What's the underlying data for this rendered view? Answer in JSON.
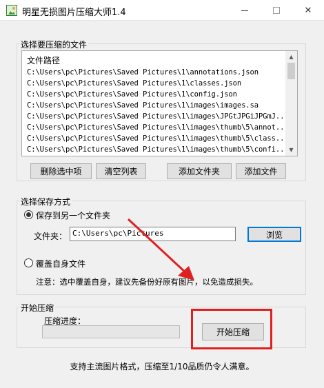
{
  "window": {
    "title": "明星无损图片压缩大师1.4",
    "min_label": "—",
    "max_label": "☐",
    "close_label": "✕"
  },
  "files_group": {
    "title": "选择要压缩的文件",
    "list_header": "文件路径",
    "rows": [
      "C:\\Users\\pc\\Pictures\\Saved Pictures\\1\\annotations.json",
      "C:\\Users\\pc\\Pictures\\Saved Pictures\\1\\classes.json",
      "C:\\Users\\pc\\Pictures\\Saved Pictures\\1\\config.json",
      "C:\\Users\\pc\\Pictures\\Saved Pictures\\1\\images\\images.sa",
      "C:\\Users\\pc\\Pictures\\Saved Pictures\\1\\images\\JPGtJPGiJPGmJ...",
      "C:\\Users\\pc\\Pictures\\Saved Pictures\\1\\images\\thumb\\5\\annot...",
      "C:\\Users\\pc\\Pictures\\Saved Pictures\\1\\images\\thumb\\5\\class...",
      "C:\\Users\\pc\\Pictures\\Saved Pictures\\1\\images\\thumb\\5\\confi..."
    ],
    "buttons": {
      "delete_selected": "删除选中项",
      "clear_list": "清空列表",
      "add_folder": "添加文件夹",
      "add_file": "添加文件"
    }
  },
  "save_group": {
    "title": "选择保存方式",
    "option_other_folder": "保存到另一个文件夹",
    "folder_label": "文件夹：",
    "folder_value": "C:\\Users\\pc\\Pictures",
    "browse_button": "浏览",
    "option_overwrite": "覆盖自身文件",
    "note": "注意：选中覆盖自身，建议先备份好原有图片，以免造成损失。"
  },
  "compress_group": {
    "title": "开始压缩",
    "progress_label": "压缩进度：",
    "progress_value": 0,
    "start_button": "开始压缩"
  },
  "footer": "支持主流图片格式，压缩至1/10品质仍令人满意。",
  "colors": {
    "accent": "#0078d7",
    "highlight": "#e02020",
    "background": "#f0f0f0"
  }
}
